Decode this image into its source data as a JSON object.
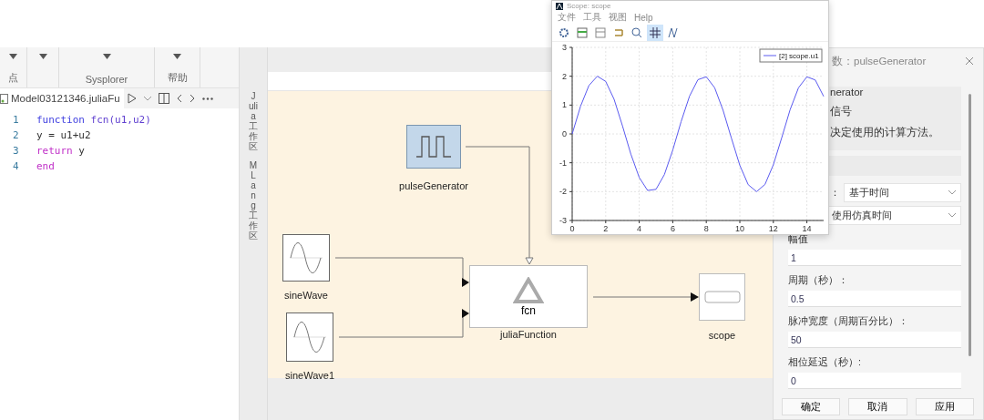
{
  "main_window": {
    "ribbon": {
      "groups": [
        {
          "kind": "dropdown",
          "label": "点"
        },
        {
          "kind": "dropdown"
        },
        {
          "kind": "dropdown",
          "label": "Sysplorer"
        },
        {
          "kind": "dropdown",
          "label": "帮助"
        }
      ]
    },
    "editor": {
      "tab": "Model03121346.juliaFu",
      "lines": [
        {
          "number": "1",
          "tokens": [
            {
              "kind": "keyword",
              "text": "function"
            },
            {
              "kind": "name",
              "text": " fcn(u1,u2)"
            }
          ]
        },
        {
          "number": "2",
          "tokens": [
            {
              "kind": "plain",
              "text": "y = u1+u2"
            }
          ]
        },
        {
          "number": "3",
          "tokens": [
            {
              "kind": "control",
              "text": "return"
            },
            {
              "kind": "plain",
              "text": " y"
            }
          ]
        },
        {
          "number": "4",
          "tokens": [
            {
              "kind": "control",
              "text": "end"
            }
          ]
        }
      ]
    },
    "side_tabs": [
      {
        "label": "Julia 工作区"
      },
      {
        "label": "MLang 工作区"
      }
    ],
    "diagram": {
      "blocks": [
        {
          "kind": "pulse",
          "label": "pulseGenerator"
        },
        {
          "kind": "sine",
          "label": "sineWave"
        },
        {
          "kind": "sine",
          "label": "sineWave1"
        },
        {
          "kind": "function",
          "label": "juliaFunction",
          "inner": "fcn"
        },
        {
          "kind": "scope",
          "label": "scope"
        }
      ]
    }
  },
  "scope_window": {
    "title": "Scope: scope",
    "menu": [
      "文件",
      "工具",
      "视图",
      "Help"
    ],
    "grid_on": true,
    "chart_data": {
      "type": "line",
      "grid": true,
      "x": [
        0,
        0.5,
        1,
        1.5,
        2,
        2.5,
        3,
        3.5,
        4,
        4.5,
        5,
        5.5,
        6,
        6.5,
        7,
        7.5,
        8,
        8.5,
        9,
        9.5,
        10,
        10.5,
        11,
        11.5,
        12,
        12.5,
        13,
        13.5,
        14,
        14.5,
        15
      ],
      "series": [
        {
          "name": "[2] scope.u1",
          "color": "#5a5af0",
          "values": [
            0,
            0.96,
            1.68,
            2.0,
            1.82,
            1.2,
            0.28,
            -0.7,
            -1.51,
            -1.96,
            -1.92,
            -1.41,
            -0.56,
            0.43,
            1.31,
            1.88,
            1.98,
            1.6,
            0.82,
            -0.15,
            -1.09,
            -1.76,
            -2.0,
            -1.75,
            -1.07,
            -0.13,
            0.84,
            1.6,
            1.98,
            1.87,
            1.3
          ]
        }
      ],
      "xlim": [
        0,
        15
      ],
      "ylim": [
        -3,
        3
      ],
      "xticks": [
        0,
        2,
        4,
        6,
        8,
        10,
        12,
        14
      ],
      "yticks": [
        -3,
        -2,
        -1,
        0,
        1,
        2,
        3
      ]
    }
  },
  "dialog": {
    "title": "数：pulseGenerator",
    "group_title": "nerator",
    "group_name": "信号",
    "group_desc": "决定使用的计算方法。",
    "selects": [
      {
        "label": "：",
        "value": "基于时间"
      },
      {
        "value": "使用仿真时间"
      }
    ],
    "fields": [
      {
        "label": "幅值",
        "value": "1"
      },
      {
        "label": "周期（秒）：",
        "value": "0.5"
      },
      {
        "label": "脉冲宽度（周期百分比）：",
        "value": "50"
      },
      {
        "label": "相位延迟（秒）:",
        "value": "0"
      }
    ],
    "buttons": [
      "确定",
      "取消",
      "应用"
    ]
  }
}
